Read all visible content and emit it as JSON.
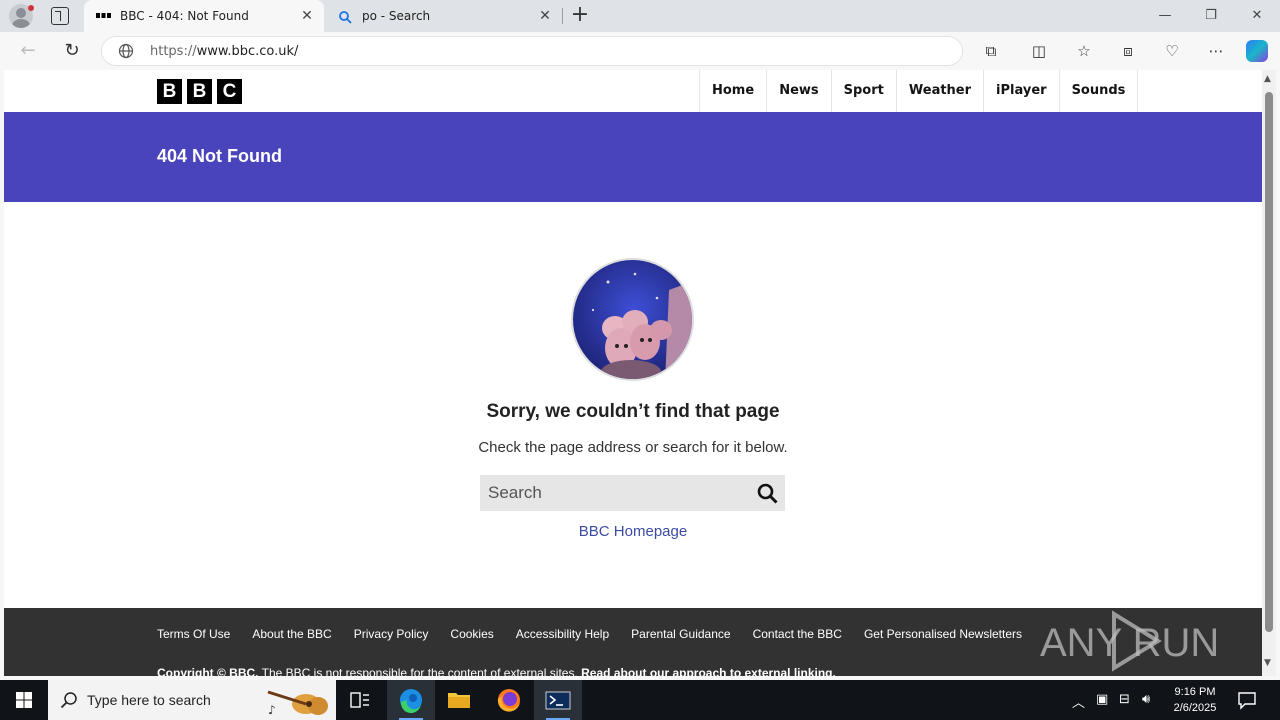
{
  "browser": {
    "tabs": [
      {
        "title": "BBC - 404: Not Found",
        "active": true
      },
      {
        "title": "po - Search",
        "active": false
      }
    ],
    "address": {
      "scheme": "https://",
      "host": "www.bbc.co.uk/"
    }
  },
  "page": {
    "logo_letters": [
      "B",
      "B",
      "C"
    ],
    "nav": [
      "Home",
      "News",
      "Sport",
      "Weather",
      "iPlayer",
      "Sounds"
    ],
    "banner_title": "404 Not Found",
    "error_title": "Sorry, we couldn’t find that page",
    "error_subtitle": "Check the page address or search for it below.",
    "search_placeholder": "Search",
    "homepage_link": "BBC Homepage",
    "footer_links": [
      "Terms Of Use",
      "About the BBC",
      "Privacy Policy",
      "Cookies",
      "Accessibility Help",
      "Parental Guidance",
      "Contact the BBC",
      "Get Personalised Newsletters"
    ],
    "footer_copy": {
      "brand": "Copyright © BBC.",
      "text": " The BBC is not responsible for the content of external sites. ",
      "link": "Read about our approach to external linking."
    },
    "watermark": "ANY RUN"
  },
  "taskbar": {
    "search_text": "Type here to search",
    "time": "9:16 PM",
    "date": "2/6/2025"
  },
  "colors": {
    "banner": "#4a44bc",
    "footer": "#323232",
    "link": "#3b4ba0"
  }
}
